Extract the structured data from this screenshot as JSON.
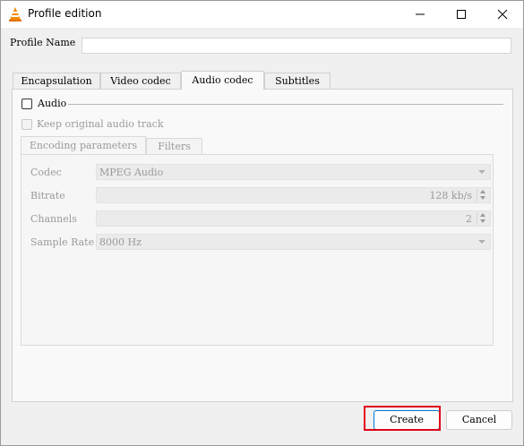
{
  "window": {
    "title": "Profile edition",
    "minimize_icon": "minimize-icon",
    "maximize_icon": "maximize-icon",
    "close_icon": "close-icon"
  },
  "profile": {
    "name_label": "Profile Name",
    "name_value": ""
  },
  "tabs": [
    {
      "label": "Encapsulation",
      "active": false
    },
    {
      "label": "Video codec",
      "active": false
    },
    {
      "label": "Audio codec",
      "active": true
    },
    {
      "label": "Subtitles",
      "active": false
    }
  ],
  "audio": {
    "enable_label": "Audio",
    "enabled": false,
    "keep_original_label": "Keep original audio track",
    "keep_original": false,
    "subtabs": [
      {
        "label": "Encoding parameters",
        "active": true
      },
      {
        "label": "Filters",
        "active": false
      }
    ],
    "fields": {
      "codec_label": "Codec",
      "codec_value": "MPEG Audio",
      "bitrate_label": "Bitrate",
      "bitrate_value": "128 kb/s",
      "channels_label": "Channels",
      "channels_value": "2",
      "samplerate_label": "Sample Rate",
      "samplerate_value": "8000 Hz"
    }
  },
  "buttons": {
    "create": "Create",
    "cancel": "Cancel"
  },
  "colors": {
    "highlight": "#e0001a",
    "accent": "#0078d4",
    "disabled_text": "#9a9a9a"
  }
}
